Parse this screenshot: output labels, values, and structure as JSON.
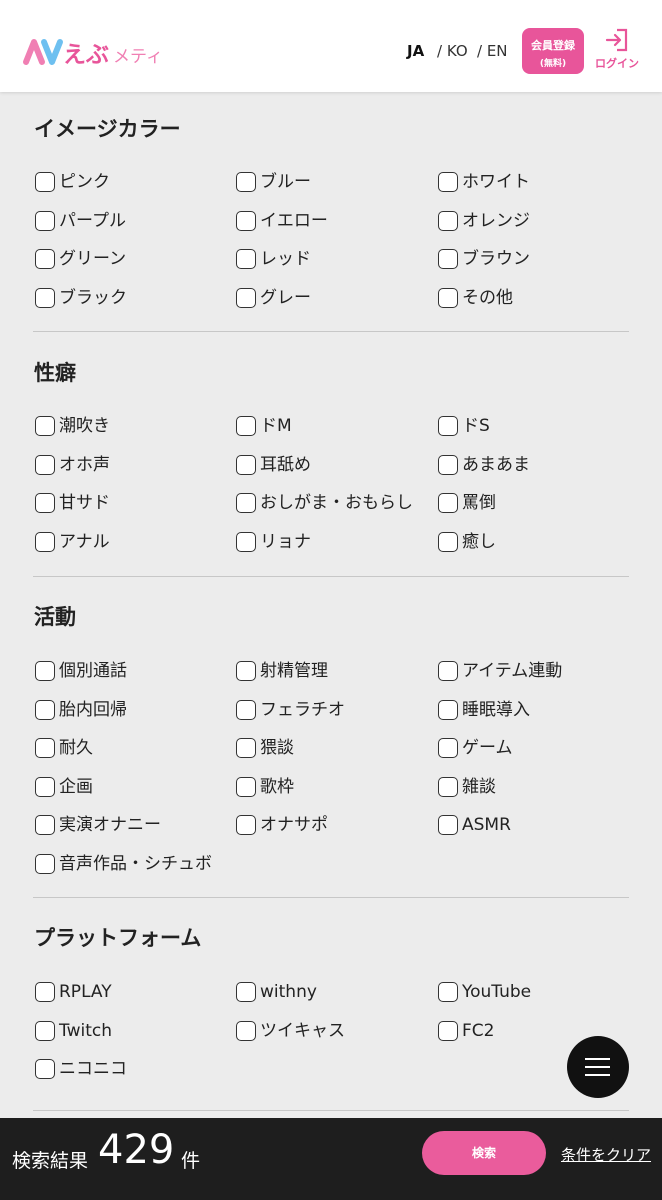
{
  "header": {
    "logo_text": "AVえぶメティ",
    "languages": [
      "JA",
      "/ KO",
      "/ EN"
    ],
    "register": {
      "line1": "会員登録",
      "line2": "(無料)"
    },
    "login_label": "ログイン",
    "brand_color": "#e8559a"
  },
  "sections": [
    {
      "title": "イメージカラー",
      "options": [
        "ピンク",
        "ブルー",
        "ホワイト",
        "パープル",
        "イエロー",
        "オレンジ",
        "グリーン",
        "レッド",
        "ブラウン",
        "ブラック",
        "グレー",
        "その他"
      ]
    },
    {
      "title": "性癖",
      "options": [
        "潮吹き",
        "ドM",
        "ドS",
        "オホ声",
        "耳舐め",
        "あまあま",
        "甘サド",
        "おしがま・おもらし",
        "罵倒",
        "アナル",
        "リョナ",
        "癒し"
      ]
    },
    {
      "title": "活動",
      "options": [
        "個別通話",
        "射精管理",
        "アイテム連動",
        "胎内回帰",
        "フェラチオ",
        "睡眠導入",
        "耐久",
        "猥談",
        "ゲーム",
        "企画",
        "歌枠",
        "雑談",
        "実演オナニー",
        "オナサポ",
        "ASMR",
        "音声作品・シチュボ"
      ]
    },
    {
      "title": "プラットフォーム",
      "options": [
        "RPLAY",
        "withny",
        "YouTube",
        "Twitch",
        "ツイキャス",
        "FC2",
        "ニコニコ"
      ]
    }
  ],
  "results": {
    "label": "検索結果",
    "count": "429",
    "unit": "件"
  },
  "search_label": "検索",
  "clear_label": "条件をクリア",
  "menu_icon": "hamburger-menu-icon"
}
